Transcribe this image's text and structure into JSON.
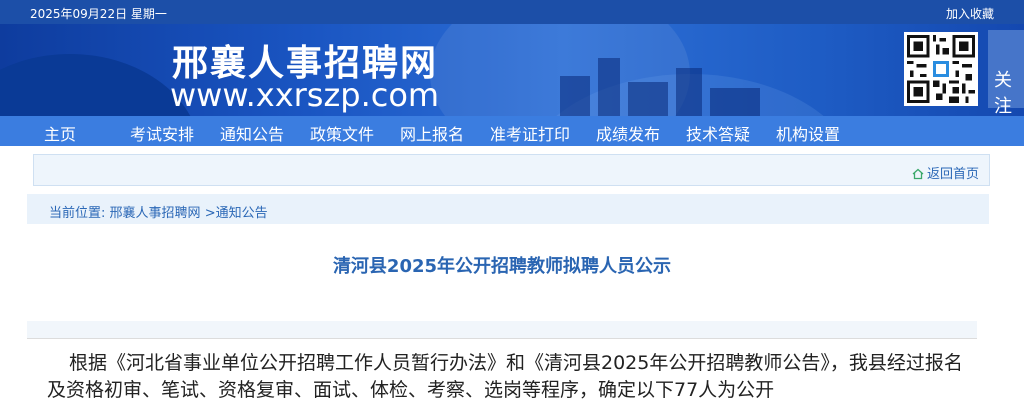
{
  "topbar": {
    "date": "2025年09月22日 星期一",
    "favorite": "加入收藏"
  },
  "banner": {
    "site_name": "邢襄人事招聘网",
    "url": "www.xxrszp.com",
    "follow": "关注"
  },
  "nav": {
    "items": [
      "主页",
      "考试安排",
      "通知公告",
      "政策文件",
      "网上报名",
      "准考证打印",
      "成绩发布",
      "技术答疑",
      "机构设置"
    ]
  },
  "return_bar": {
    "back_label": "返回首页"
  },
  "breadcrumb": {
    "prefix": "当前位置:",
    "home": "邢襄人事招聘网",
    "sep": ">",
    "current": "通知公告"
  },
  "article": {
    "title": "清河县2025年公开招聘教师拟聘人员公示",
    "body": "根据《河北省事业单位公开招聘工作人员暂行办法》和《清河县2025年公开招聘教师公告》，我县经过报名及资格初审、笔试、资格复审、面试、体检、考察、选岗等程序，确定以下77人为公开"
  },
  "colors": {
    "topbar": "#1c4fa8",
    "nav": "#3b7de0",
    "link": "#2a67b6",
    "title": "#2a65b2"
  }
}
